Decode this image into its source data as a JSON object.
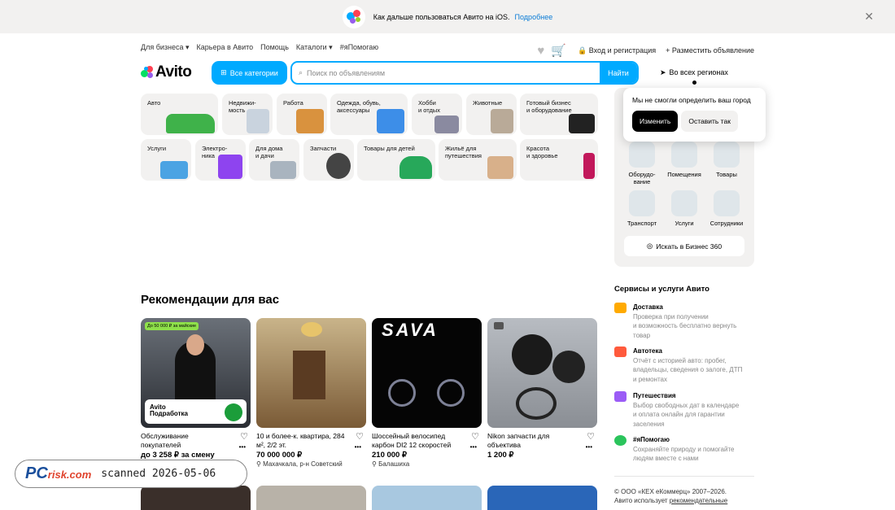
{
  "banner": {
    "text": "Как дальше пользоваться Авито на iOS.",
    "link": "Подробнее"
  },
  "topnav": {
    "items": [
      "Для бизнеса",
      "Карьера в Авито",
      "Помощь",
      "Каталоги",
      "#яПомогаю"
    ]
  },
  "topright": {
    "login": "Вход и регистрация",
    "post": "Разместить объявление"
  },
  "logo": {
    "text": "Avito"
  },
  "header": {
    "categories_button": "Все категории",
    "search_placeholder": "Поиск по объявлениям",
    "search_button": "Найти",
    "region": "Во всех регионах"
  },
  "categories": [
    {
      "label": "Авто"
    },
    {
      "label": "Недвижи-\nмость"
    },
    {
      "label": "Работа"
    },
    {
      "label": "Одежда, обувь,\nаксессуары"
    },
    {
      "label": "Хобби\nи отдых"
    },
    {
      "label": "Животные"
    },
    {
      "label": "Готовый бизнес\nи оборудование"
    },
    {
      "label": "Услуги"
    },
    {
      "label": "Электро-\nника"
    },
    {
      "label": "Для дома\nи дачи"
    },
    {
      "label": "Запчасти"
    },
    {
      "label": "Товары для детей"
    },
    {
      "label": "Жильё для\nпутешествия"
    },
    {
      "label": "Красота\nи здоровье"
    }
  ],
  "popup": {
    "text": "Мы не смогли определить ваш город",
    "change": "Изменить",
    "keep": "Оставить так"
  },
  "business": {
    "items": [
      "Оборудо-\nвание",
      "Помещения",
      "Товары",
      "Транспорт",
      "Услуги",
      "Сотрудники"
    ],
    "link": "Искать в Бизнес 360"
  },
  "recommendations": {
    "title": "Рекомендации для вас",
    "cards": [
      {
        "badge": "До 50 000 ₽ за майские",
        "overlay": "Avito\nПодработка",
        "title": "Обслуживание покупателей",
        "price": "до 3 258 ₽ за смену",
        "location": ""
      },
      {
        "title": "10 и более-к. квартира, 284 м², 2/2 эт.",
        "price": "70 000 000 ₽",
        "location": "Махачкала, р-н Советский"
      },
      {
        "overlay": "SAVA",
        "title": "Шоссейный велосипед карбон DI2 12 скоростей",
        "price": "210 000 ₽",
        "location": "Балашиха"
      },
      {
        "title": "Nikon запчасти для объектива",
        "price": "1 200 ₽",
        "location": ""
      }
    ]
  },
  "services": {
    "title": "Сервисы и услуги Авито",
    "items": [
      {
        "name": "Доставка",
        "desc": "Проверка при получении\nи возможность бесплатно вернуть\nтовар",
        "color": "#ffaa00"
      },
      {
        "name": "Автотека",
        "desc": "Отчёт с историей авто: пробег,\nвладельцы, сведения о залоге, ДТП\nи ремонтах",
        "color": "#ff5a3c"
      },
      {
        "name": "Путешествия",
        "desc": "Выбор свободных дат в календаре\nи оплата онлайн для гарантии\nзаселения",
        "color": "#9b5cf6"
      },
      {
        "name": "#яПомогаю",
        "desc": "Сохраняйте природу и помогайте\nлюдям вместе с нами",
        "color": "#2bc45c"
      }
    ]
  },
  "footer": {
    "line1": "© ООО «КЕХ еКоммерц» 2007–2026.",
    "line2": "Авито использует ",
    "line2_link": "рекомендательные"
  },
  "watermark": {
    "logo": "PC",
    "logo_suffix": "risk.com",
    "scanned": "scanned 2026-05-06"
  }
}
